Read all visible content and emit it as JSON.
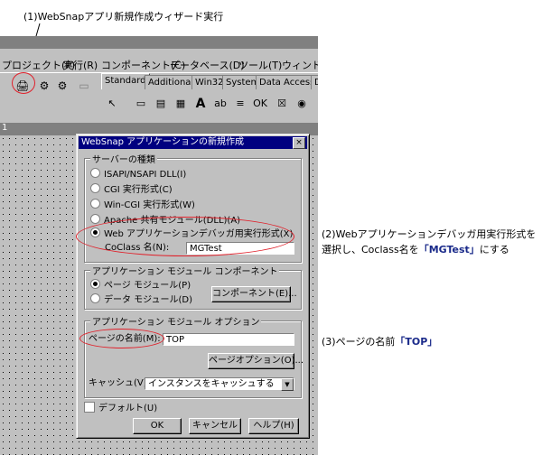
{
  "annotations": {
    "step1": "(1)WebSnapアプリ新規作成ウィザード実行",
    "step2_line1": "(2)Webアプリケーションデバッガ用実行形式を",
    "step2_line2_pre": "選択し、Coclass名を",
    "step2_highlight": "「MGTest」",
    "step2_line2_post": "にする",
    "step3_pre": "(3)ページの名前",
    "step3_highlight": "「TOP」"
  },
  "menu": [
    "プロジェクト(P)",
    "実行(R)",
    "コンポーネント(C)",
    "データベース(D)",
    "ツール(T)",
    "ウィンドウ"
  ],
  "palette_tabs": [
    "Standard",
    "Additional",
    "Win32",
    "System",
    "Data Access",
    "D"
  ],
  "form_caption": "1",
  "dialog": {
    "title": "WebSnap アプリケーションの新規作成",
    "close": "×",
    "server_group": "サーバーの種類",
    "server_options": [
      "ISAPI/NSAPI DLL(I)",
      "CGI 実行形式(C)",
      "Win-CGI 実行形式(W)",
      "Apache 共有モジュール(DLL)(A)",
      "Web アプリケーションデバッガ用実行形式(X)"
    ],
    "coclass_label": "CoClass 名(N):",
    "coclass_value": "MGTest",
    "component_group": "アプリケーション モジュール コンポーネント",
    "component_options": [
      "ページ モジュール(P)",
      "データ モジュール(D)"
    ],
    "component_button": "コンポーネント(E)...",
    "option_group": "アプリケーション モジュール オプション",
    "page_name_label": "ページの名前(M):",
    "page_name_value": "TOP",
    "page_options_button": "ページオプション(O)...",
    "cache_label": "キャッシュ(V):",
    "cache_value": "インスタンスをキャッシュする",
    "default_label": "デフォルト(U)",
    "ok": "OK",
    "cancel": "キャンセル",
    "help": "ヘルプ(H)"
  }
}
